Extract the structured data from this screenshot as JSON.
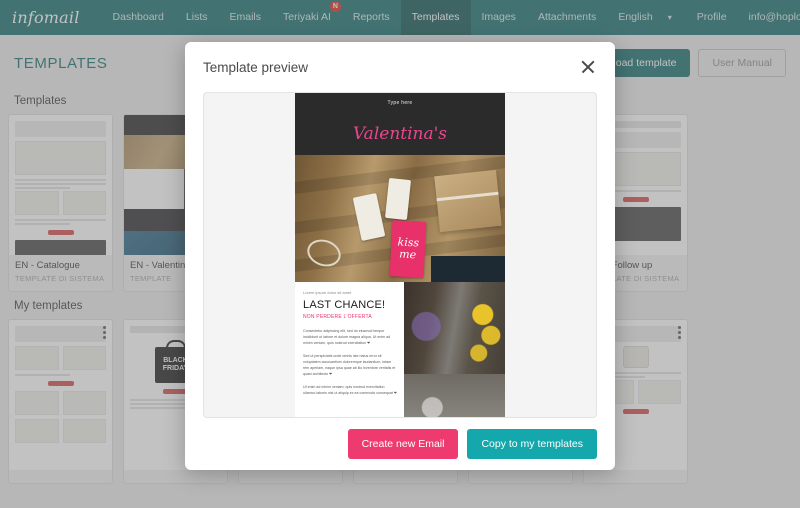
{
  "navbar": {
    "brand": "infomail",
    "items": [
      {
        "label": "Dashboard",
        "active": false,
        "badge": ""
      },
      {
        "label": "Lists",
        "active": false,
        "badge": ""
      },
      {
        "label": "Emails",
        "active": false,
        "badge": ""
      },
      {
        "label": "Teriyaki AI",
        "active": false,
        "badge": "N"
      },
      {
        "label": "Reports",
        "active": false,
        "badge": ""
      },
      {
        "label": "Templates",
        "active": true,
        "badge": ""
      },
      {
        "label": "Images",
        "active": false,
        "badge": ""
      },
      {
        "label": "Attachments",
        "active": false,
        "badge": ""
      }
    ],
    "language": "English",
    "caret": "▾",
    "profile": "Profile",
    "account": "info@hoplo.com",
    "brand_color": "#17706e",
    "active_color": "#0f5654",
    "badge_color": "#d93025"
  },
  "header": {
    "title": "TEMPLATES",
    "upload_label": "Upload template",
    "manual_label": "User Manual"
  },
  "sections": {
    "templates_title": "Templates",
    "my_templates_title": "My templates"
  },
  "system_templates": [
    {
      "name": "EN - Catalogue",
      "sub": "TEMPLATE DI SISTEMA"
    },
    {
      "name": "EN - Valentine",
      "sub": "TEMPLATE"
    },
    {
      "name": "",
      "sub": ""
    },
    {
      "name": "",
      "sub": ""
    },
    {
      "name": "nnouncement",
      "sub": "TE"
    },
    {
      "name": "EN - Follow up",
      "sub": "TEMPLATE DI SISTEMA"
    }
  ],
  "my_templates": [
    {
      "name": "",
      "sub": ""
    },
    {
      "name": "",
      "sub": ""
    },
    {
      "name": "",
      "sub": ""
    },
    {
      "name": "",
      "sub": ""
    },
    {
      "name": "",
      "sub": ""
    },
    {
      "name": "",
      "sub": ""
    }
  ],
  "modal": {
    "title": "Template preview",
    "close_icon": "close-icon",
    "create_label": "Create new Email",
    "copy_label": "Copy to my templates",
    "create_color": "#ee3a6e",
    "copy_color": "#14a8ac"
  },
  "preview": {
    "topbar_text": "Type here",
    "logo_text": "Valentina's",
    "kiss_line1": "kiss",
    "kiss_line2": "me",
    "kicker": "Lorem ipsum dolor sit amet",
    "headline": "LAST CHANCE!",
    "subhead": "NON PERDERE L'OFFERTA",
    "para1": "Consectetur adipiscing elit, sed do eiusmod tempor incididunt ut labore et dolore magna aliqua. Ut enim ad minim veniam, quis nostrud exercitation ❤",
    "para2": "Sed ut perspiciatis unde omnis iste natus error sit voluptatem accusantium doloremque laudantium, totam rem aperiam, eaque ipsa quae ab illo inventore veritatis et quasi architecto ❤",
    "para3": "Ut enim ad minim veniam, quis nostrud exercitation ullamco laboris nisi ut aliquip ex ea commodo consequat ❤"
  }
}
